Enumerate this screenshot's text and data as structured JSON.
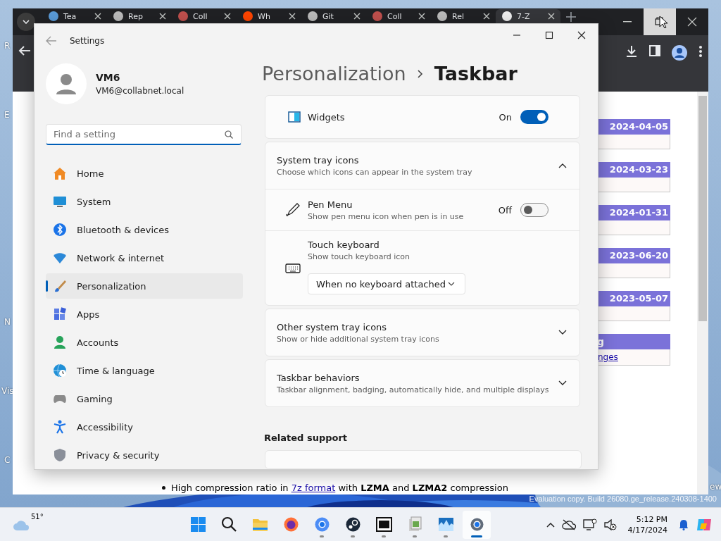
{
  "desktop": {
    "icon_labels": [
      "R",
      "E",
      "N",
      "Vis",
      "C"
    ],
    "edge_label": "ew",
    "notice": "Evaluation copy. Build 26080.ge_release.240308-1400"
  },
  "browser": {
    "tabs": [
      {
        "label": "Tea",
        "selected": false
      },
      {
        "label": "Rep",
        "selected": false
      },
      {
        "label": "Coll",
        "selected": false
      },
      {
        "label": "Wh",
        "selected": false
      },
      {
        "label": "Git",
        "selected": false
      },
      {
        "label": "Coll",
        "selected": false
      },
      {
        "label": "Rel",
        "selected": false
      },
      {
        "label": "7-Z",
        "selected": true
      }
    ],
    "controls": [
      {
        "kind": "minimize",
        "hovered": false
      },
      {
        "kind": "restore",
        "hovered": true
      },
      {
        "kind": "close",
        "hovered": false
      }
    ],
    "page": {
      "releases": [
        {
          "date": "2024-04-05"
        },
        {
          "date": "2024-03-23"
        },
        {
          "date": "2024-01-31"
        },
        {
          "date": "2023-06-20"
        },
        {
          "date": "2023-05-07"
        }
      ],
      "section": {
        "heading": "g",
        "link": "nges"
      },
      "bullets": [
        {
          "text": "High compression ratio in ",
          "link": "7z format",
          "after": " with **LZMA** and **LZMA2** compression"
        }
      ]
    }
  },
  "settings": {
    "title": "Settings",
    "user": {
      "name": "VM6",
      "email": "VM6@collabnet.local"
    },
    "search": {
      "placeholder": "Find a setting"
    },
    "nav": [
      {
        "label": "Home",
        "selected": false
      },
      {
        "label": "System",
        "selected": false
      },
      {
        "label": "Bluetooth & devices",
        "selected": false
      },
      {
        "label": "Network & internet",
        "selected": false
      },
      {
        "label": "Personalization",
        "selected": true
      },
      {
        "label": "Apps",
        "selected": false
      },
      {
        "label": "Accounts",
        "selected": false
      },
      {
        "label": "Time & language",
        "selected": false
      },
      {
        "label": "Gaming",
        "selected": false
      },
      {
        "label": "Accessibility",
        "selected": false
      },
      {
        "label": "Privacy & security",
        "selected": false
      }
    ],
    "breadcrumb": {
      "parent": "Personalization",
      "current": "Taskbar"
    },
    "cards": [
      {
        "kind": "toggle",
        "label": "Widgets",
        "on": true,
        "state_text": "On"
      },
      {
        "kind": "expander",
        "title": "System tray icons",
        "subtitle": "Choose which icons can appear in the system tray",
        "expanded": true,
        "children": [
          {
            "kind": "toggle",
            "label": "Pen Menu",
            "description": "Show pen menu icon when pen is in use",
            "on": false,
            "state_text": "Off"
          },
          {
            "kind": "dropdown",
            "label": "Touch keyboard",
            "description": "Show touch keyboard icon",
            "value": "When no keyboard attached"
          }
        ]
      },
      {
        "kind": "expander",
        "title": "Other system tray icons",
        "subtitle": "Show or hide additional system tray icons",
        "expanded": false
      },
      {
        "kind": "expander",
        "title": "Taskbar behaviors",
        "subtitle": "Taskbar alignment, badging, automatically hide, and multiple displays",
        "expanded": false
      }
    ],
    "related_support": "Related support"
  },
  "taskbar": {
    "weather": "51°",
    "apps": [
      {
        "running": false,
        "active": false
      },
      {
        "running": false,
        "active": false
      },
      {
        "running": false,
        "active": false
      },
      {
        "running": false,
        "active": false
      },
      {
        "running": true,
        "active": false
      },
      {
        "running": true,
        "active": false
      },
      {
        "running": true,
        "active": false
      },
      {
        "running": true,
        "active": false
      },
      {
        "running": true,
        "active": false
      },
      {
        "running": true,
        "active": true
      }
    ],
    "time": "5:12 PM",
    "date": "4/17/2024"
  }
}
